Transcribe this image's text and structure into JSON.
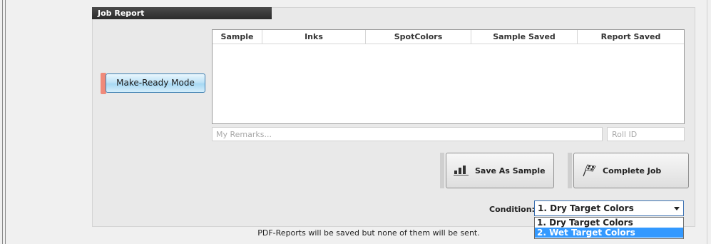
{
  "panel": {
    "title": "Job Report"
  },
  "make_ready": {
    "label": "Make-Ready Mode"
  },
  "table": {
    "columns": [
      "Sample",
      "Inks",
      "SpotColors",
      "Sample Saved",
      "Report Saved"
    ]
  },
  "remarks": {
    "placeholder": "My Remarks..."
  },
  "roll_id": {
    "placeholder": "Roll ID"
  },
  "buttons": {
    "save_sample": "Save As Sample",
    "complete_job": "Complete Job"
  },
  "condition": {
    "label": "Condition:",
    "selected": "1. Dry Target Colors",
    "options": [
      "1. Dry Target Colors",
      "2. Wet Target Colors"
    ]
  },
  "footer": {
    "note": "PDF-Reports will be saved but none of them will be sent."
  },
  "colors": {
    "accent_red": "#f08a7a",
    "selection_blue": "#3399ff",
    "title_bar": "#2b2b2b"
  }
}
